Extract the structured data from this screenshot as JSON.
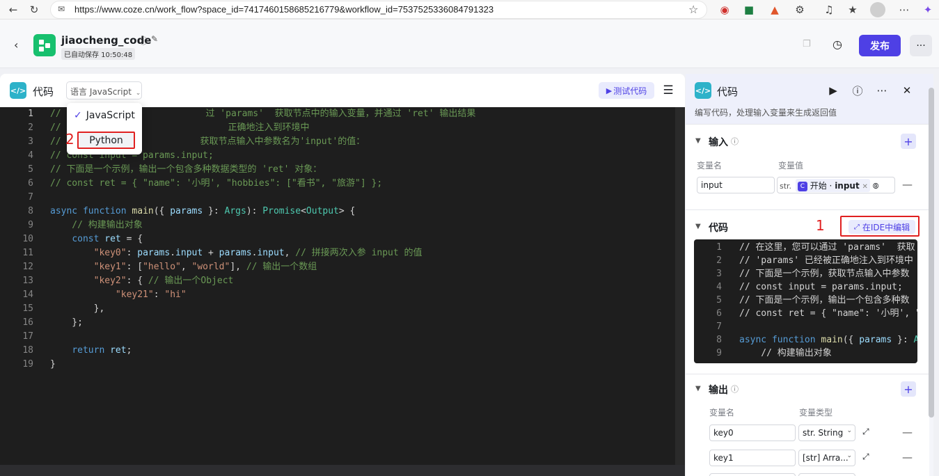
{
  "browser": {
    "url": "https://www.coze.cn/work_flow?space_id=7417460158685216779&workflow_id=7537525336084791323"
  },
  "header": {
    "title": "jiaocheng_code",
    "saved_status": "已自动保存 10:50:48",
    "publish_label": "发布",
    "more_label": "···"
  },
  "editor": {
    "title": "代码",
    "language_label": "语言 JavaScript",
    "test_label": "测试代码",
    "line_numbers": [
      "1",
      "2",
      "3",
      "4",
      "5",
      "6",
      "7",
      "8",
      "9",
      "10",
      "11",
      "12",
      "13",
      "14",
      "15",
      "16",
      "17",
      "18",
      "19"
    ],
    "lines": [
      "// 在这里，您可以通过 'params'  获取节点中的输入变量，并通过 'ret' 输出结果",
      "// 'params' 已经被正确地注入到环境中",
      "// 下面是一个示例，获取节点输入中参数名为'input'的值：",
      "// const input = params.input;",
      "// 下面是一个示例，输出一个包含多种数据类型的 'ret' 对象：",
      "// const ret = { \"name\": '小明', \"hobbies\": [\"看书\", \"旅游\"] };",
      "",
      "async function main({ params }: Args): Promise<Output> {",
      "    // 构建输出对象",
      "    const ret = {",
      "        \"key0\": params.input + params.input, // 拼接两次入参 input 的值",
      "        \"key1\": [\"hello\", \"world\"], // 输出一个数组",
      "        \"key2\": { // 输出一个Object",
      "            \"key21\": \"hi\"",
      "        },",
      "    };",
      "",
      "    return ret;",
      "}"
    ],
    "visible_line_1_tail": "过 'params'  获取节点中的输入变量，并通过 'ret' 输出结果",
    "visible_line_2_tail": "正确地注入到环境中",
    "visible_line_3_tail": "获取节点输入中参数名为'input'的值："
  },
  "dropdown": {
    "options": [
      "JavaScript",
      "Python"
    ],
    "selected": "JavaScript",
    "annotation": "2"
  },
  "panel": {
    "title": "代码",
    "description": "编写代码，处理输入变量来生成返回值",
    "input_section": {
      "title": "输入",
      "col_name": "变量名",
      "col_value": "变量值",
      "var_name": "input",
      "type_abbr": "str.",
      "ref_source": "开始",
      "ref_var": "input"
    },
    "code_section": {
      "title": "代码",
      "ide_button": "在IDE中编辑",
      "annotation": "1",
      "lines": [
        "// 在这里，您可以通过 'params'  获取",
        "// 'params' 已经被正确地注入到环境中",
        "// 下面是一个示例，获取节点输入中参数",
        "// const input = params.input;",
        "// 下面是一个示例，输出一个包含多种数",
        "// const ret = { \"name\": '小明', \"",
        "",
        "async function main({ params }: Ar",
        "    // 构建输出对象"
      ]
    },
    "output_section": {
      "title": "输出",
      "col_name": "变量名",
      "col_type": "变量类型",
      "rows": [
        {
          "name": "key0",
          "type": "str. String"
        },
        {
          "name": "key1",
          "type": "[str] Arra..."
        }
      ]
    }
  },
  "colors": {
    "accent": "#4e40e5",
    "annotation_red": "#e02020",
    "editor_bg": "#1e1e1e",
    "code_icon": "#2db2c9"
  }
}
